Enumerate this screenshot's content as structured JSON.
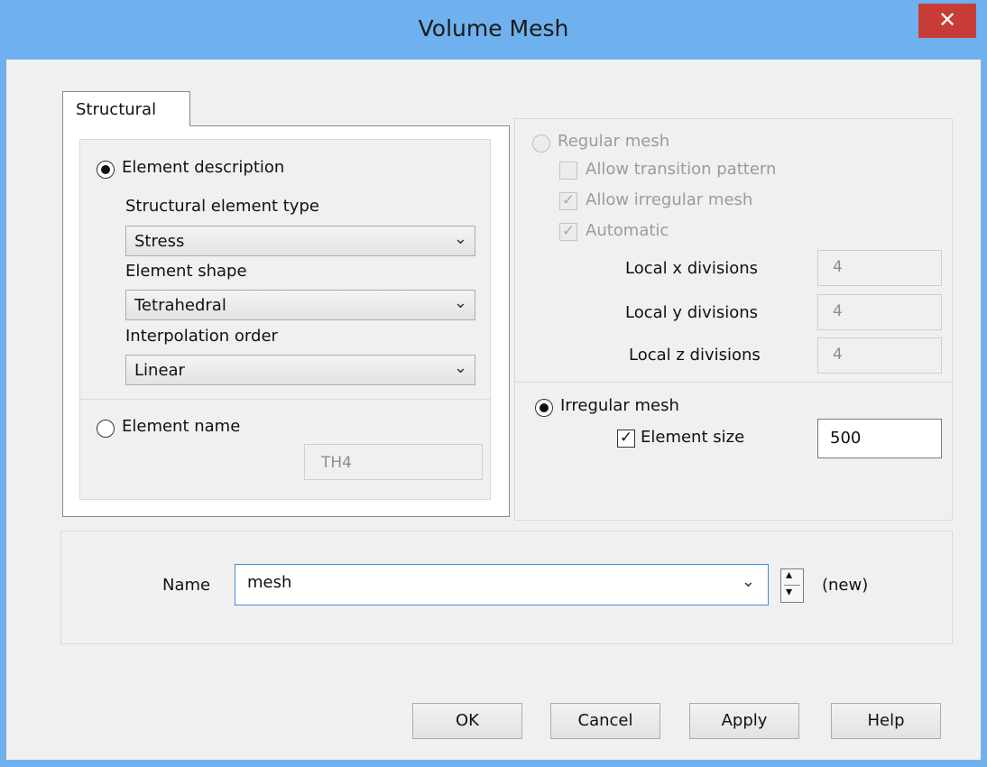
{
  "window": {
    "title": "Volume Mesh",
    "close_glyph": "✕"
  },
  "tabs": {
    "structural": "Structural"
  },
  "element": {
    "description_label": "Element description",
    "type_label": "Structural element type",
    "type_value": "Stress",
    "shape_label": "Element shape",
    "shape_value": "Tetrahedral",
    "order_label": "Interpolation order",
    "order_value": "Linear",
    "name_label": "Element name",
    "name_value": "TH4",
    "selected": "description"
  },
  "mesh": {
    "regular_label": "Regular mesh",
    "allow_transition_label": "Allow transition pattern",
    "allow_irregular_label": "Allow irregular mesh",
    "automatic_label": "Automatic",
    "local_x_label": "Local x divisions",
    "local_x_value": "4",
    "local_y_label": "Local y divisions",
    "local_y_value": "4",
    "local_z_label": "Local z divisions",
    "local_z_value": "4",
    "irregular_label": "Irregular mesh",
    "element_size_label": "Element size",
    "element_size_value": "500",
    "selected": "irregular",
    "allow_transition_checked": false,
    "allow_irregular_checked": true,
    "automatic_checked": true,
    "element_size_checked": true
  },
  "name_row": {
    "label": "Name",
    "value": "mesh",
    "status": "(new)"
  },
  "buttons": {
    "ok": "OK",
    "cancel": "Cancel",
    "apply": "Apply",
    "help": "Help"
  },
  "glyphs": {
    "chevron": "⌄",
    "check": "✓",
    "up": "▴",
    "down": "▾"
  },
  "colors": {
    "title_bar": "#6fb0ee",
    "close_button": "#c73c37",
    "client": "#f0f0f0"
  }
}
